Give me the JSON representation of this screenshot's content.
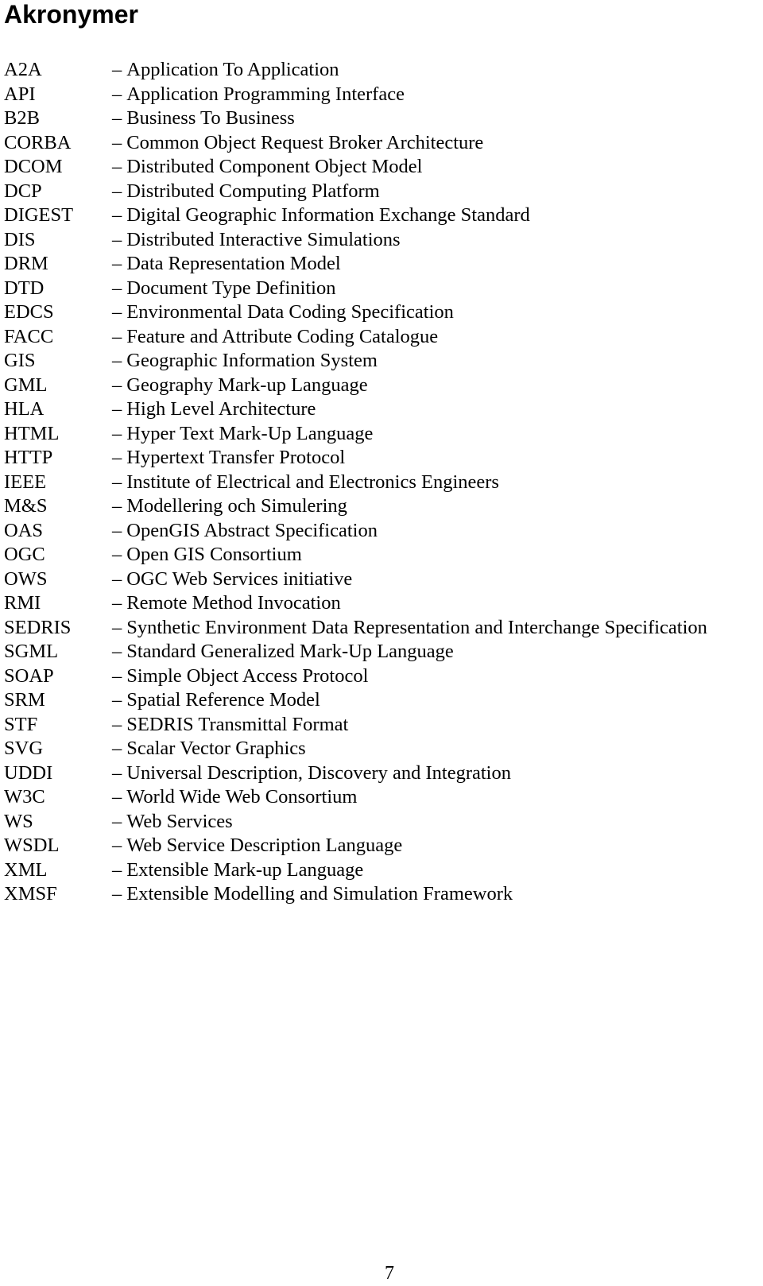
{
  "title": "Akronymer",
  "separator": "–",
  "acronyms": [
    {
      "abbr": "A2A",
      "meaning": "Application To Application"
    },
    {
      "abbr": "API",
      "meaning": "Application Programming Interface"
    },
    {
      "abbr": "B2B",
      "meaning": "Business To Business"
    },
    {
      "abbr": "CORBA",
      "meaning": "Common Object Request Broker Architecture"
    },
    {
      "abbr": "DCOM",
      "meaning": "Distributed Component Object Model"
    },
    {
      "abbr": "DCP",
      "meaning": "Distributed Computing Platform"
    },
    {
      "abbr": "DIGEST",
      "meaning": "Digital Geographic Information Exchange Standard"
    },
    {
      "abbr": "DIS",
      "meaning": "Distributed Interactive Simulations"
    },
    {
      "abbr": "DRM",
      "meaning": "Data Representation Model"
    },
    {
      "abbr": "DTD",
      "meaning": "Document Type Definition"
    },
    {
      "abbr": "EDCS",
      "meaning": "Environmental Data Coding Specification"
    },
    {
      "abbr": "FACC",
      "meaning": "Feature and Attribute Coding Catalogue"
    },
    {
      "abbr": "GIS",
      "meaning": "Geographic Information System"
    },
    {
      "abbr": "GML",
      "meaning": "Geography Mark-up Language"
    },
    {
      "abbr": "HLA",
      "meaning": "High Level Architecture"
    },
    {
      "abbr": "HTML",
      "meaning": "Hyper Text Mark-Up Language"
    },
    {
      "abbr": "HTTP",
      "meaning": "Hypertext Transfer Protocol"
    },
    {
      "abbr": "IEEE",
      "meaning": "Institute of Electrical and Electronics Engineers"
    },
    {
      "abbr": "M&S",
      "meaning": "Modellering och Simulering"
    },
    {
      "abbr": "OAS",
      "meaning": "OpenGIS Abstract Specification"
    },
    {
      "abbr": "OGC",
      "meaning": "Open GIS Consortium"
    },
    {
      "abbr": "OWS",
      "meaning": "OGC Web Services initiative"
    },
    {
      "abbr": "RMI",
      "meaning": "Remote Method Invocation"
    },
    {
      "abbr": "SEDRIS",
      "meaning": "Synthetic Environment Data Representation and Interchange Specification"
    },
    {
      "abbr": "SGML",
      "meaning": "Standard Generalized Mark-Up Language"
    },
    {
      "abbr": "SOAP",
      "meaning": "Simple Object Access Protocol"
    },
    {
      "abbr": "SRM",
      "meaning": "Spatial Reference Model"
    },
    {
      "abbr": "STF",
      "meaning": "SEDRIS Transmittal Format"
    },
    {
      "abbr": "SVG",
      "meaning": "Scalar Vector Graphics"
    },
    {
      "abbr": "UDDI",
      "meaning": "Universal Description, Discovery and Integration"
    },
    {
      "abbr": "W3C",
      "meaning": "World Wide Web Consortium"
    },
    {
      "abbr": "WS",
      "meaning": "Web Services"
    },
    {
      "abbr": "WSDL",
      "meaning": "Web Service Description Language"
    },
    {
      "abbr": "XML",
      "meaning": "Extensible Mark-up Language"
    },
    {
      "abbr": "XMSF",
      "meaning": "Extensible Modelling and Simulation Framework"
    }
  ],
  "page_number": "7"
}
